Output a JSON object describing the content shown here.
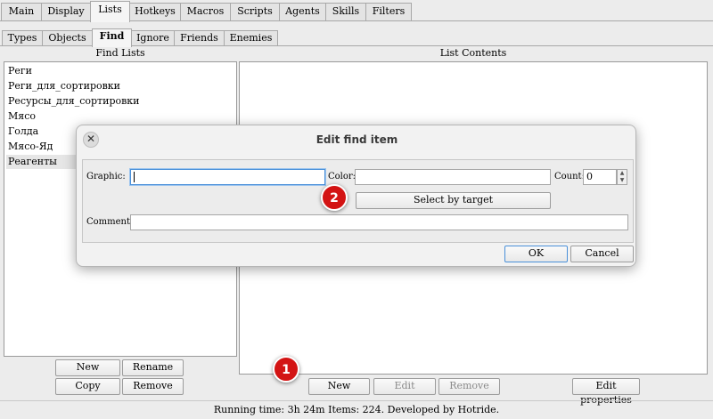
{
  "main_tabs": [
    "Main",
    "Display",
    "Lists",
    "Hotkeys",
    "Macros",
    "Scripts",
    "Agents",
    "Skills",
    "Filters"
  ],
  "sub_tabs": [
    "Types",
    "Objects",
    "Find",
    "Ignore",
    "Friends",
    "Enemies"
  ],
  "find_lists": {
    "header": "Find Lists",
    "items": [
      "Реги",
      "Реги_для_сортировки",
      "Ресурсы_для_сортировки",
      "Мясо",
      "Голда",
      "Мясо-Яд",
      "Реагенты"
    ],
    "new_label": "New",
    "rename_label": "Rename",
    "copy_label": "Copy",
    "remove_label": "Remove"
  },
  "list_contents": {
    "header": "List Contents",
    "new_label": "New",
    "edit_label": "Edit",
    "remove_label": "Remove",
    "edit_properties_label": "Edit properties"
  },
  "status": "Running time: 3h 24m Items: 224. Developed by Hotride.",
  "dialog": {
    "title": "Edit find item",
    "close_glyph": "✕",
    "graphic_label": "Graphic:",
    "graphic_value": "",
    "color_label": "Color:",
    "color_value": "",
    "count_label": "Count:",
    "count_value": "0",
    "select_by_target_label": "Select by target",
    "comment_label": "Comment:",
    "comment_value": "",
    "ok_label": "OK",
    "cancel_label": "Cancel"
  },
  "badges": {
    "one": "1",
    "two": "2"
  },
  "colors": {
    "badge": "#d31414",
    "focus": "#4a90d9"
  }
}
